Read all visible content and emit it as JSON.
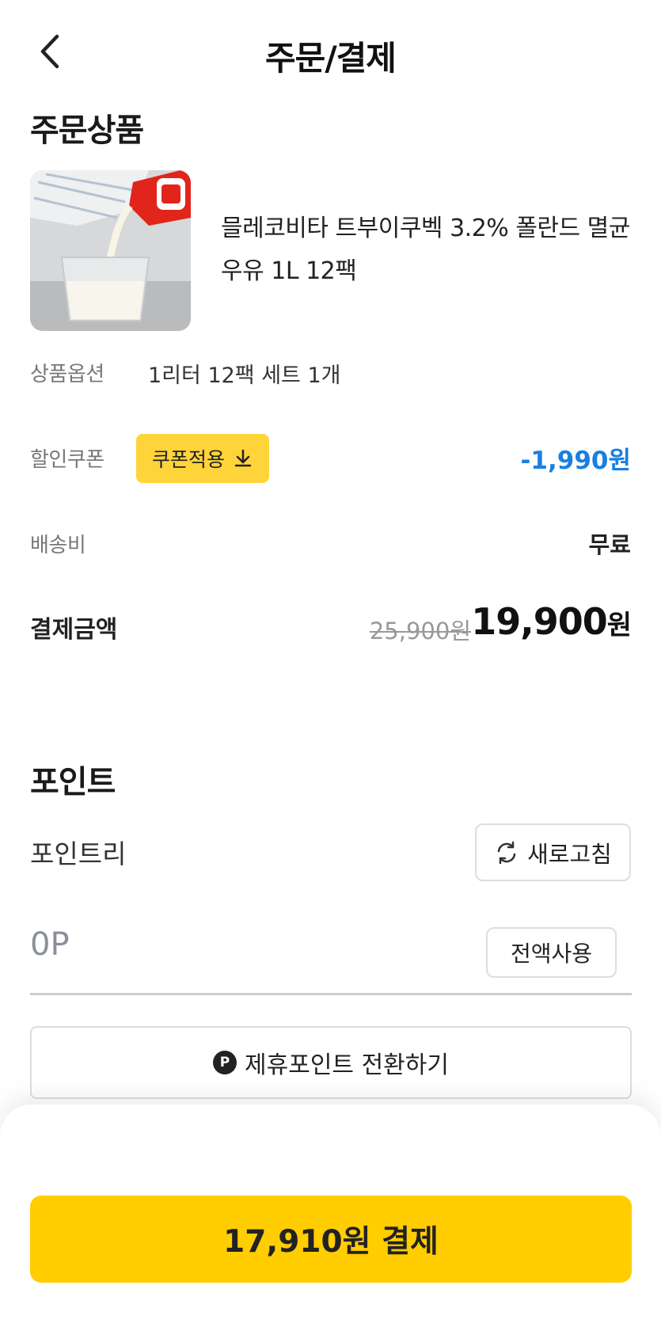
{
  "header": {
    "title": "주문/결제"
  },
  "order_section": {
    "title": "주문상품",
    "product_name": "믈레코비타 트부이쿠벡 3.2% 폴란드 멸균우유 1L 12팩",
    "option_label": "상품옵션",
    "option_value": "1리터 12팩 세트 1개",
    "coupon_label": "할인쿠폰",
    "coupon_button": "쿠폰적용",
    "discount": "-1,990원",
    "shipping_label": "배송비",
    "shipping_value": "무료",
    "total_label": "결제금액",
    "original_price": "25,900원",
    "final_price_number": "19,900",
    "final_price_unit": "원"
  },
  "points_section": {
    "title": "포인트",
    "label": "포인트리",
    "refresh_button": "새로고침",
    "value": "0P",
    "use_all_button": "전액사용",
    "convert_badge": "P",
    "convert_button": "제휴포인트 전환하기"
  },
  "footer": {
    "pay_button": "17,910원 결제"
  },
  "colors": {
    "accent_yellow": "#ffcd00",
    "discount_blue": "#1a7fe0"
  }
}
